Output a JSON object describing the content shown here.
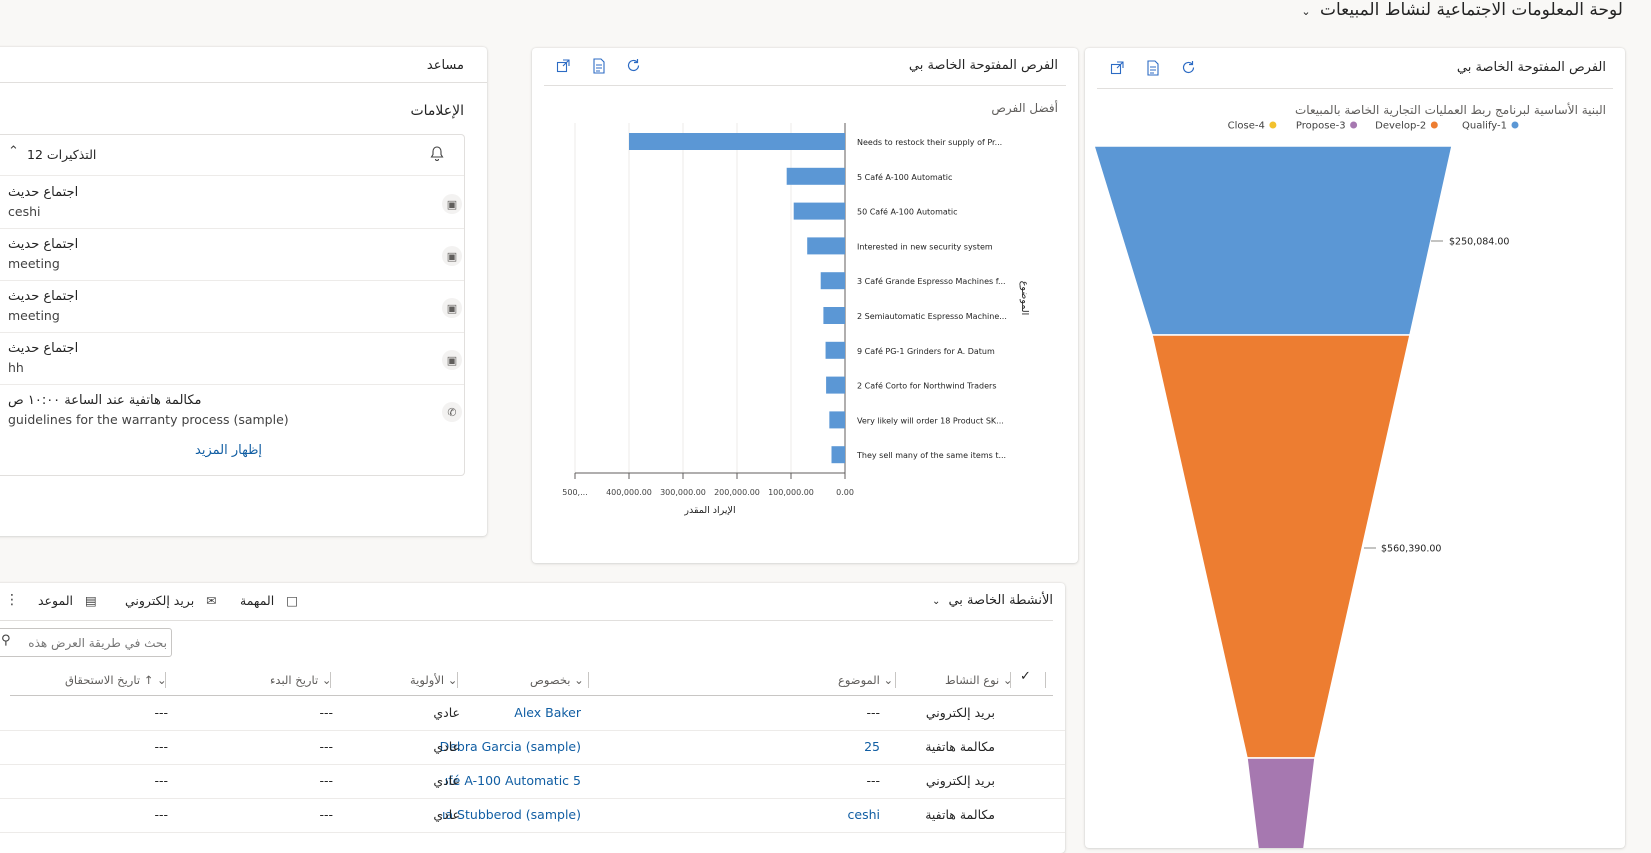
{
  "page": {
    "title": "لوحة المعلومات الاجتماعية لنشاط المبيعات",
    "title_chevron": "chevron-down-icon"
  },
  "assistant": {
    "title": "مساعد",
    "notifications_heading": "الإعلامات",
    "reminders_label": "12 التذكيرات",
    "items": [
      {
        "title": "اجتماع حديث",
        "subtitle": "ceshi",
        "icon": "calendar-icon"
      },
      {
        "title": "اجتماع حديث",
        "subtitle": "meeting",
        "icon": "calendar-icon"
      },
      {
        "title": "اجتماع حديث",
        "subtitle": "meeting",
        "icon": "calendar-icon"
      },
      {
        "title": "اجتماع حديث",
        "subtitle": "hh",
        "icon": "calendar-icon"
      },
      {
        "title": "مكالمة هاتفية عند الساعة ١٠:٠٠ ص",
        "subtitle": "guidelines for the warranty process (sample)",
        "icon": "phone-icon"
      }
    ],
    "show_more": "إظهار المزيد"
  },
  "bar_card": {
    "title": "الفرص المفتوحة الخاصة بي",
    "chart_title": "أفضل الفرص"
  },
  "funnel_card": {
    "title": "الفرص المفتوحة الخاصة بي",
    "chart_title": "البنية الأساسية لبرنامج ربط العمليات التجارية الخاصة بالمبيعات"
  },
  "activities": {
    "title": "الأنشطة الخاصة بي",
    "toolbar": {
      "appointment": "الموعد",
      "email": "بريد إلكتروني",
      "task": "المهمة",
      "more": "⋮"
    },
    "search_placeholder": "بحث في طريقة العرض هذه",
    "columns": {
      "type": "نوع النشاط",
      "subject": "الموضوع",
      "regarding": "بخصوص",
      "priority": "الأولوية",
      "start": "تاريخ البدء",
      "due": "تاريخ الاستحقاق"
    },
    "rows": [
      {
        "type": "بريد إلكتروني",
        "subject": "---",
        "regarding": "Alex Baker",
        "priority": "عادي",
        "start": "---",
        "due": "---"
      },
      {
        "type": "مكالمة هاتفية",
        "subject": "25",
        "regarding": "Debra Garcia (sample)",
        "priority": "عادي",
        "start": "---",
        "due": "---"
      },
      {
        "type": "بريد إلكتروني",
        "subject": "---",
        "regarding": "ıfé A-100 Automatic 5",
        "priority": "عادي",
        "start": "---",
        "due": "---"
      },
      {
        "type": "مكالمة هاتفية",
        "subject": "ceshi",
        "regarding": "ıa Stubberod (sample)",
        "priority": "عادي",
        "start": "---",
        "due": "---"
      }
    ]
  },
  "chart_data": [
    {
      "type": "bar",
      "orientation": "horizontal",
      "title": "أفضل الفرص",
      "xlabel": "الإيراد المقدر",
      "ylabel": "الموضوع",
      "x_axis_reversed": true,
      "xlim": [
        0,
        500000
      ],
      "xticks": [
        "0.00",
        "100,000.00",
        "200,000.00",
        "300,000.00",
        "400,000.00",
        "500,..."
      ],
      "categories": [
        "Needs to restock their supply of Pr...",
        "5 Café A-100 Automatic",
        "50 Café A-100 Automatic",
        "Interested in new security system",
        "3 Café Grande Espresso Machines f...",
        "2 Semiautomatic Espresso Machine...",
        "9 Café PG-1 Grinders for A. Datum",
        "2 Café Corto for Northwind Traders",
        "Very likely will order 18 Product SK...",
        "They sell many of the same items t..."
      ],
      "values": [
        400000,
        108000,
        95000,
        70000,
        45000,
        40000,
        36000,
        35000,
        29000,
        25000
      ],
      "color": "#5b97d5",
      "grid": true
    },
    {
      "type": "funnel",
      "title": "البنية الأساسية لبرنامج ربط العمليات التجارية الخاصة بالمبيعات",
      "legend": [
        {
          "name": "Qualify-1",
          "color": "#5b97d5"
        },
        {
          "name": "Develop-2",
          "color": "#ed7d31"
        },
        {
          "name": "Propose-3",
          "color": "#a678b0"
        },
        {
          "name": "Close-4",
          "color": "#f2c12e"
        }
      ],
      "stages": [
        {
          "name": "Qualify-1",
          "label": "$250,084.00",
          "color": "#5b97d5"
        },
        {
          "name": "Develop-2",
          "label": "$560,390.00",
          "color": "#ed7d31"
        },
        {
          "name": "Propose-3",
          "label": "",
          "color": "#a678b0"
        }
      ],
      "legend_position": "top-right"
    }
  ]
}
